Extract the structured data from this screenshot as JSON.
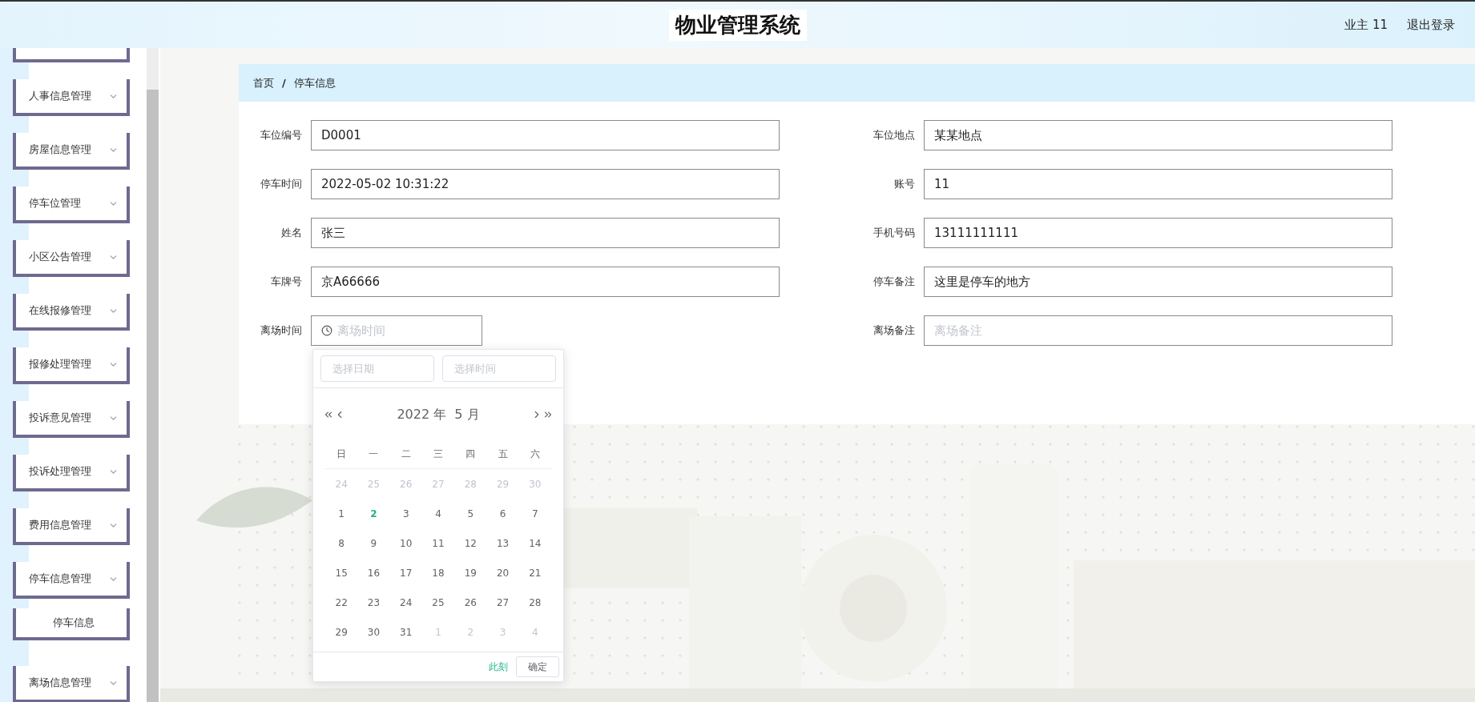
{
  "header": {
    "title": "物业管理系统",
    "user": "业主 11",
    "logout": "退出登录"
  },
  "sidebar": {
    "items": [
      {
        "label": "人事信息管理"
      },
      {
        "label": "房屋信息管理"
      },
      {
        "label": "停车位管理"
      },
      {
        "label": "小区公告管理"
      },
      {
        "label": "在线报修管理"
      },
      {
        "label": "报修处理管理"
      },
      {
        "label": "投诉意见管理"
      },
      {
        "label": "投诉处理管理"
      },
      {
        "label": "费用信息管理"
      },
      {
        "label": "停车信息管理",
        "children": [
          {
            "label": "停车信息"
          }
        ]
      },
      {
        "label": "离场信息管理"
      }
    ]
  },
  "breadcrumb": {
    "items": [
      "首页",
      "停车信息"
    ],
    "separator": "/"
  },
  "form": {
    "fields": [
      {
        "kind": "text",
        "label": "车位编号",
        "value": "D0001"
      },
      {
        "kind": "text",
        "label": "车位地点",
        "value": "某某地点"
      },
      {
        "kind": "text",
        "label": "停车时间",
        "value": "2022-05-02 10:31:22"
      },
      {
        "kind": "text",
        "label": "账号",
        "value": "11"
      },
      {
        "kind": "text",
        "label": "姓名",
        "value": "张三"
      },
      {
        "kind": "text",
        "label": "手机号码",
        "value": "13111111111"
      },
      {
        "kind": "text",
        "label": "车牌号",
        "value": "京A66666"
      },
      {
        "kind": "text",
        "label": "停车备注",
        "value": "这里是停车的地方"
      },
      {
        "kind": "datetime",
        "label": "离场时间",
        "placeholder": "离场时间"
      },
      {
        "kind": "text",
        "label": "离场备注",
        "placeholder": "离场备注"
      }
    ]
  },
  "date_picker": {
    "date_placeholder": "选择日期",
    "time_placeholder": "选择时间",
    "title": "2022 年  5 月",
    "weekdays": [
      "日",
      "一",
      "二",
      "三",
      "四",
      "五",
      "六"
    ],
    "days": [
      {
        "label": "24",
        "in_month": false,
        "today": false
      },
      {
        "label": "25",
        "in_month": false,
        "today": false
      },
      {
        "label": "26",
        "in_month": false,
        "today": false
      },
      {
        "label": "27",
        "in_month": false,
        "today": false
      },
      {
        "label": "28",
        "in_month": false,
        "today": false
      },
      {
        "label": "29",
        "in_month": false,
        "today": false
      },
      {
        "label": "30",
        "in_month": false,
        "today": false
      },
      {
        "label": "1",
        "in_month": true,
        "today": false
      },
      {
        "label": "2",
        "in_month": true,
        "today": true
      },
      {
        "label": "3",
        "in_month": true,
        "today": false
      },
      {
        "label": "4",
        "in_month": true,
        "today": false
      },
      {
        "label": "5",
        "in_month": true,
        "today": false
      },
      {
        "label": "6",
        "in_month": true,
        "today": false
      },
      {
        "label": "7",
        "in_month": true,
        "today": false
      },
      {
        "label": "8",
        "in_month": true,
        "today": false
      },
      {
        "label": "9",
        "in_month": true,
        "today": false
      },
      {
        "label": "10",
        "in_month": true,
        "today": false
      },
      {
        "label": "11",
        "in_month": true,
        "today": false
      },
      {
        "label": "12",
        "in_month": true,
        "today": false
      },
      {
        "label": "13",
        "in_month": true,
        "today": false
      },
      {
        "label": "14",
        "in_month": true,
        "today": false
      },
      {
        "label": "15",
        "in_month": true,
        "today": false
      },
      {
        "label": "16",
        "in_month": true,
        "today": false
      },
      {
        "label": "17",
        "in_month": true,
        "today": false
      },
      {
        "label": "18",
        "in_month": true,
        "today": false
      },
      {
        "label": "19",
        "in_month": true,
        "today": false
      },
      {
        "label": "20",
        "in_month": true,
        "today": false
      },
      {
        "label": "21",
        "in_month": true,
        "today": false
      },
      {
        "label": "22",
        "in_month": true,
        "today": false
      },
      {
        "label": "23",
        "in_month": true,
        "today": false
      },
      {
        "label": "24",
        "in_month": true,
        "today": false
      },
      {
        "label": "25",
        "in_month": true,
        "today": false
      },
      {
        "label": "26",
        "in_month": true,
        "today": false
      },
      {
        "label": "27",
        "in_month": true,
        "today": false
      },
      {
        "label": "28",
        "in_month": true,
        "today": false
      },
      {
        "label": "29",
        "in_month": true,
        "today": false
      },
      {
        "label": "30",
        "in_month": true,
        "today": false
      },
      {
        "label": "31",
        "in_month": true,
        "today": false
      },
      {
        "label": "1",
        "in_month": false,
        "today": false
      },
      {
        "label": "2",
        "in_month": false,
        "today": false
      },
      {
        "label": "3",
        "in_month": false,
        "today": false
      },
      {
        "label": "4",
        "in_month": false,
        "today": false
      }
    ],
    "now": "此刻",
    "confirm": "确定"
  }
}
